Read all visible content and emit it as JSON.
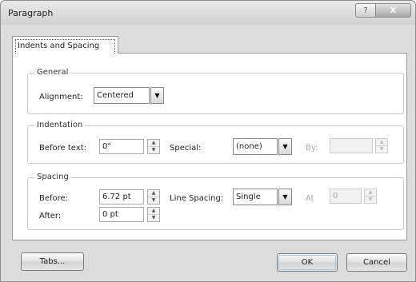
{
  "window": {
    "title": "Paragraph",
    "help_glyph": "?",
    "close_glyph": "X"
  },
  "tabs": [
    {
      "label": "Indents and Spacing"
    }
  ],
  "general": {
    "group_title": "General",
    "alignment_label": "Alignment:",
    "alignment_value": "Centered"
  },
  "indentation": {
    "group_title": "Indentation",
    "before_text_label": "Before text:",
    "before_text_value": "0\"",
    "special_label": "Special:",
    "special_value": "(none)",
    "by_label": "By:",
    "by_value": ""
  },
  "spacing": {
    "group_title": "Spacing",
    "before_label": "Before:",
    "before_value": "6.72 pt",
    "after_label": "After:",
    "after_value": "0 pt",
    "line_spacing_label": "Line Spacing:",
    "line_spacing_value": "Single",
    "at_label": "At",
    "at_value": "0"
  },
  "buttons": {
    "tabs": "Tabs...",
    "ok": "OK",
    "cancel": "Cancel"
  },
  "icons": {
    "spin_up": "▲",
    "spin_down": "▼",
    "dropdown": "▼",
    "names": [
      "help-icon",
      "close-icon",
      "spin-up-icon",
      "spin-down-icon",
      "dropdown-arrow-icon"
    ]
  },
  "colors": {
    "title_bar": "#d9d9d9",
    "panel": "#ffffff",
    "dialog": "#dcdcdc",
    "ok_focus": "#9fc7e6"
  }
}
